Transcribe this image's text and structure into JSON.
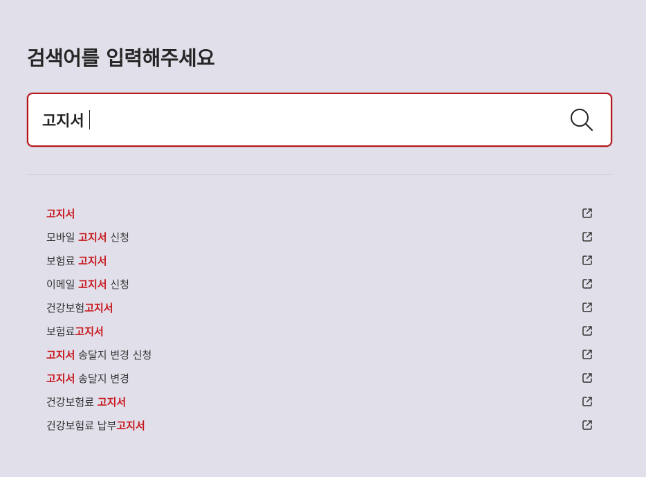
{
  "header": {
    "title": "검색어를 입력해주세요"
  },
  "search": {
    "value": "고지서",
    "icon": "search-icon",
    "border_color": "#b4161b"
  },
  "colors": {
    "highlight": "#c8161d",
    "background": "#e1e0ea"
  },
  "suggestions": [
    {
      "before": "",
      "match": "고지서",
      "after": "",
      "icon": "external-link-icon"
    },
    {
      "before": "모바일 ",
      "match": "고지서",
      "after": " 신청",
      "icon": "external-link-icon"
    },
    {
      "before": "보험료 ",
      "match": "고지서",
      "after": "",
      "icon": "external-link-icon"
    },
    {
      "before": "이메일 ",
      "match": "고지서",
      "after": " 신청",
      "icon": "external-link-icon"
    },
    {
      "before": "건강보험",
      "match": "고지서",
      "after": "",
      "icon": "external-link-icon"
    },
    {
      "before": "보험료",
      "match": "고지서",
      "after": "",
      "icon": "external-link-icon"
    },
    {
      "before": "",
      "match": "고지서",
      "after": " 송달지 변경 신청",
      "icon": "external-link-icon"
    },
    {
      "before": "",
      "match": "고지서",
      "after": " 송달지 변경",
      "icon": "external-link-icon"
    },
    {
      "before": "건강보험료 ",
      "match": "고지서",
      "after": "",
      "icon": "external-link-icon"
    },
    {
      "before": "건강보험료 납부",
      "match": "고지서",
      "after": "",
      "icon": "external-link-icon"
    }
  ]
}
